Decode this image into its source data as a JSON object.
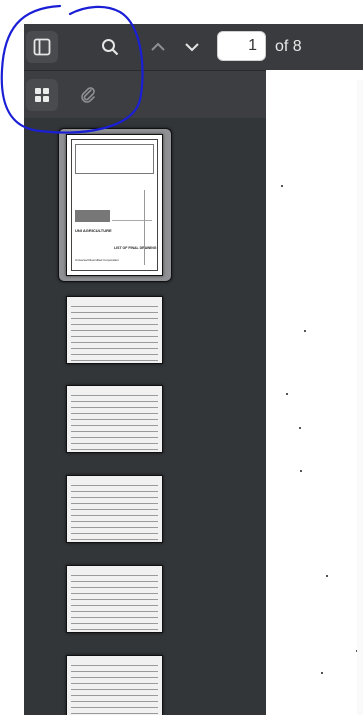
{
  "toolbar": {
    "page_current": "1",
    "page_total_label": "of 8",
    "icons": [
      "sidebar-toggle-icon",
      "search-icon",
      "chevron-up-icon",
      "chevron-down-icon"
    ]
  },
  "sidebar": {
    "tabs": [
      "thumbnails-grid-icon",
      "attachment-paperclip-icon"
    ],
    "active_tab": "thumbnails-grid-icon",
    "cover_thumbnail": {
      "company_heading": "UNI AGRICULTURE",
      "drawing_title": "LIST OF FINAL DRAWING",
      "company_name": "Universal Diversified Corporation"
    }
  },
  "colors": {
    "toolbar_bg": "#3a3b3e",
    "sidebar_bg": "#323639",
    "annotation": "#1a1fd6"
  }
}
